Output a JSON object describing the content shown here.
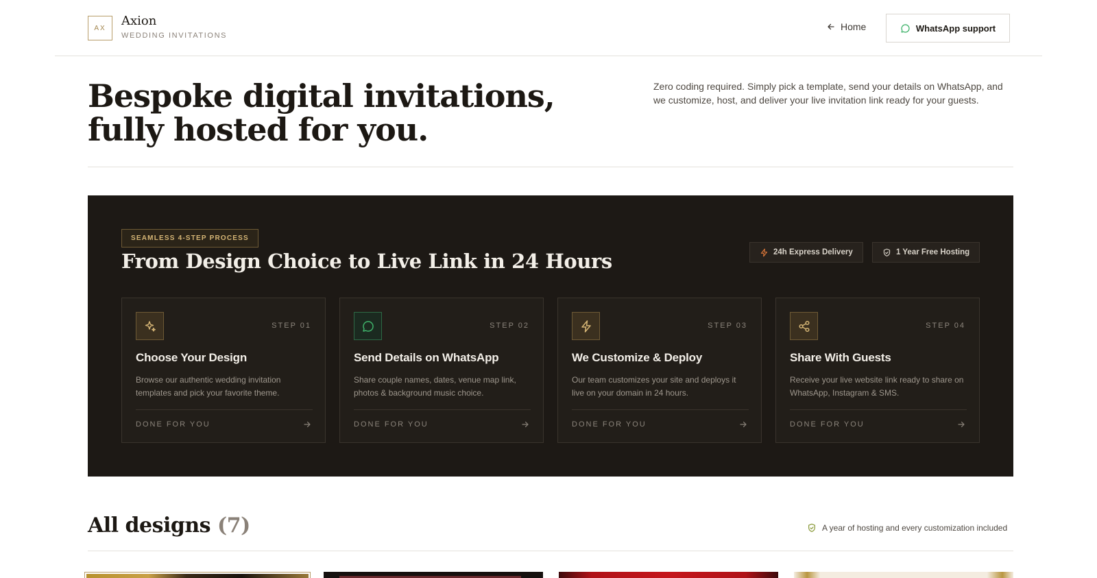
{
  "header": {
    "logo_mark": "AX",
    "brand_name": "Axion",
    "brand_sub": "WEDDING INVITATIONS",
    "home_label": "Home",
    "whatsapp_label": "WhatsApp support"
  },
  "hero": {
    "title": "Bespoke digital invitations, fully hosted for you.",
    "description": "Zero coding required. Simply pick a template, send your details on WhatsApp, and we customize, host, and deliver your live invitation link ready for your guests."
  },
  "process": {
    "badge": "SEAMLESS 4-STEP PROCESS",
    "title": "From Design Choice to Live Link in 24 Hours",
    "perks": [
      {
        "label": "24h Express Delivery",
        "icon": "lightning-icon"
      },
      {
        "label": "1 Year Free Hosting",
        "icon": "shield-check-icon"
      }
    ],
    "steps": [
      {
        "step": "STEP 01",
        "title": "Choose Your Design",
        "desc": "Browse our authentic wedding invitation templates and pick your favorite theme.",
        "footer": "DONE FOR YOU",
        "icon": "sparkles-icon",
        "icon_color": "#d6b676"
      },
      {
        "step": "STEP 02",
        "title": "Send Details on WhatsApp",
        "desc": "Share couple names, dates, venue map link, photos & background music choice.",
        "footer": "DONE FOR YOU",
        "icon": "chat-bubble-icon",
        "icon_color": "#3fb26a"
      },
      {
        "step": "STEP 03",
        "title": "We Customize & Deploy",
        "desc": "Our team customizes your site and deploys it live on your domain in 24 hours.",
        "footer": "DONE FOR YOU",
        "icon": "lightning-icon",
        "icon_color": "#d6b676"
      },
      {
        "step": "STEP 04",
        "title": "Share With Guests",
        "desc": "Receive your live website link ready to share on WhatsApp, Instagram & SMS.",
        "footer": "DONE FOR YOU",
        "icon": "share-icon",
        "icon_color": "#d6b676"
      }
    ]
  },
  "designs": {
    "title": "All designs",
    "count": "(7)",
    "note": "A year of hosting and every customization included"
  },
  "colors": {
    "accent_gold": "#b89d6a",
    "dark_bg": "#1d1915",
    "whatsapp_green": "#3fb26a",
    "perk_orange": "#e0793a"
  }
}
